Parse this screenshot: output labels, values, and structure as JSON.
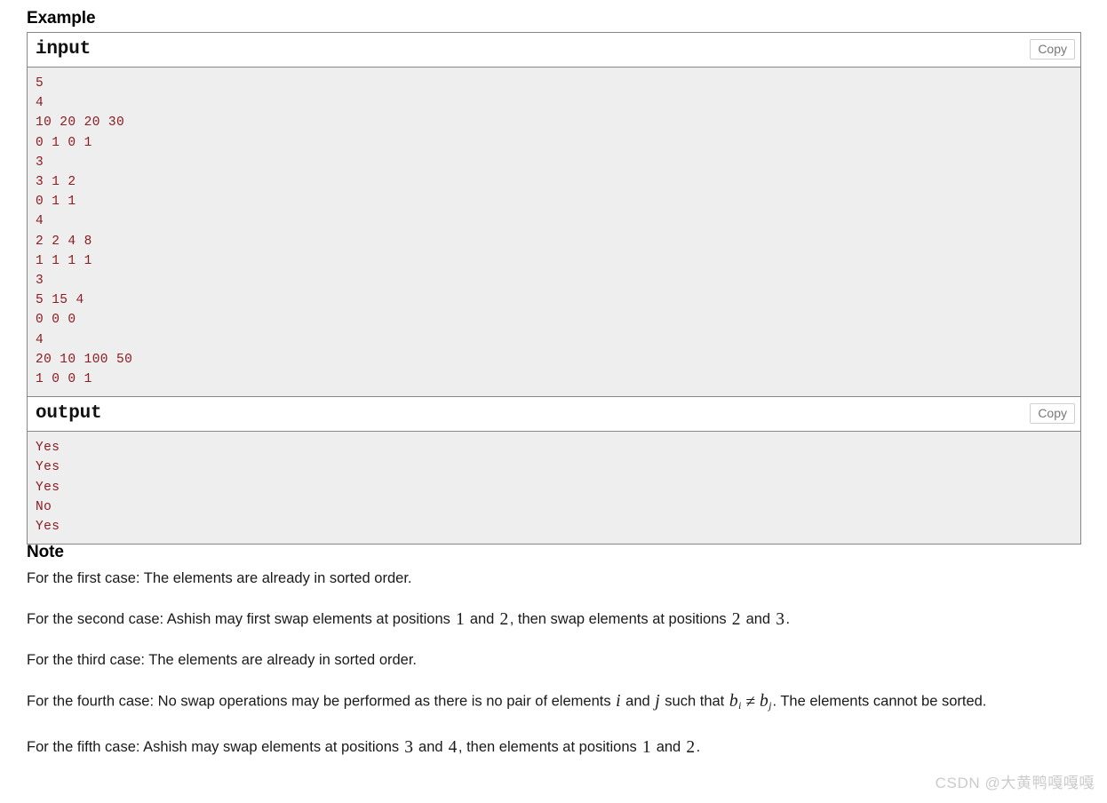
{
  "example": {
    "heading": "Example",
    "blocks": [
      {
        "title": "input",
        "copy_label": "Copy",
        "lines": [
          "5",
          "4",
          "10 20 20 30",
          "0 1 0 1",
          "3",
          "3 1 2",
          "0 1 1",
          "4",
          "2 2 4 8",
          "1 1 1 1",
          "3",
          "5 15 4",
          "0 0 0",
          "4",
          "20 10 100 50",
          "1 0 0 1"
        ]
      },
      {
        "title": "output",
        "copy_label": "Copy",
        "lines": [
          "Yes",
          "Yes",
          "Yes",
          "No",
          "Yes"
        ]
      }
    ]
  },
  "note": {
    "heading": "Note",
    "paragraphs": [
      {
        "id": "first",
        "parts": [
          {
            "type": "text",
            "value": "For the first case: The elements are already in sorted order."
          }
        ]
      },
      {
        "id": "second",
        "parts": [
          {
            "type": "text",
            "value": "For the second case: Ashish may first swap elements at positions "
          },
          {
            "type": "math",
            "value": "1"
          },
          {
            "type": "text",
            "value": " and "
          },
          {
            "type": "math",
            "value": "2"
          },
          {
            "type": "text",
            "value": ", then swap elements at positions "
          },
          {
            "type": "math",
            "value": "2"
          },
          {
            "type": "text",
            "value": " and "
          },
          {
            "type": "math",
            "value": "3"
          },
          {
            "type": "text",
            "value": "."
          }
        ]
      },
      {
        "id": "third",
        "parts": [
          {
            "type": "text",
            "value": "For the third case: The elements are already in sorted order."
          }
        ]
      },
      {
        "id": "fourth",
        "parts": [
          {
            "type": "text",
            "value": "For the fourth case: No swap operations may be performed as there is no pair of elements "
          },
          {
            "type": "mathvar",
            "value": "i"
          },
          {
            "type": "text",
            "value": " and "
          },
          {
            "type": "mathvar",
            "value": "j"
          },
          {
            "type": "text",
            "value": " such that "
          },
          {
            "type": "mathsub",
            "base": "b",
            "sub": "i"
          },
          {
            "type": "mathop",
            "value": "≠"
          },
          {
            "type": "mathsub",
            "base": "b",
            "sub": "j"
          },
          {
            "type": "text",
            "value": ". The elements cannot be sorted."
          }
        ]
      },
      {
        "id": "fifth",
        "parts": [
          {
            "type": "text",
            "value": "For the fifth case: Ashish may swap elements at positions "
          },
          {
            "type": "math",
            "value": "3"
          },
          {
            "type": "text",
            "value": " and "
          },
          {
            "type": "math",
            "value": "4"
          },
          {
            "type": "text",
            "value": ", then elements at positions "
          },
          {
            "type": "math",
            "value": "1"
          },
          {
            "type": "text",
            "value": " and "
          },
          {
            "type": "math",
            "value": "2"
          },
          {
            "type": "text",
            "value": "."
          }
        ]
      }
    ]
  },
  "watermark": {
    "text": "CSDN @大黄鸭嘎嘎嘎"
  },
  "colors": {
    "code_text": "#8b1c22",
    "code_background": "#eeeeee",
    "panel_border": "#888888",
    "copy_button_text": "#777777",
    "watermark": "#cbcbcb"
  }
}
